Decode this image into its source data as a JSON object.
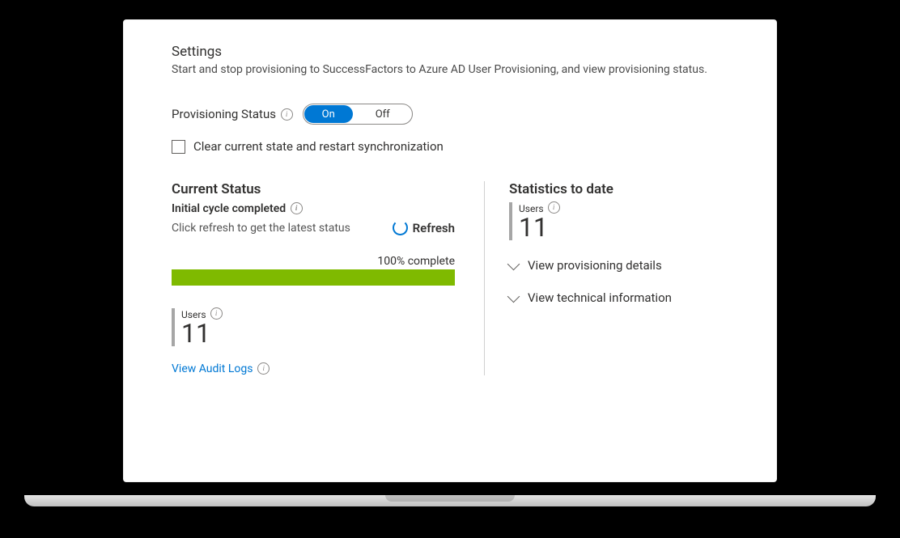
{
  "header": {
    "title": "Settings",
    "description": "Start and stop provisioning to SuccessFactors to Azure AD User Provisioning, and view provisioning status."
  },
  "provisioning": {
    "label": "Provisioning Status",
    "toggle_on": "On",
    "toggle_off": "Off",
    "selected": "On",
    "clear_label": "Clear current state and restart synchronization"
  },
  "current_status": {
    "heading": "Current Status",
    "state_line": "Initial cycle completed",
    "hint": "Click refresh to get the latest status",
    "refresh_label": "Refresh",
    "progress_text": "100% complete",
    "users_label": "Users",
    "users_count": "11",
    "audit_link": "View Audit Logs"
  },
  "statistics": {
    "heading": "Statistics to date",
    "users_label": "Users",
    "users_count": "11",
    "expand1": "View provisioning details",
    "expand2": "View technical information"
  }
}
